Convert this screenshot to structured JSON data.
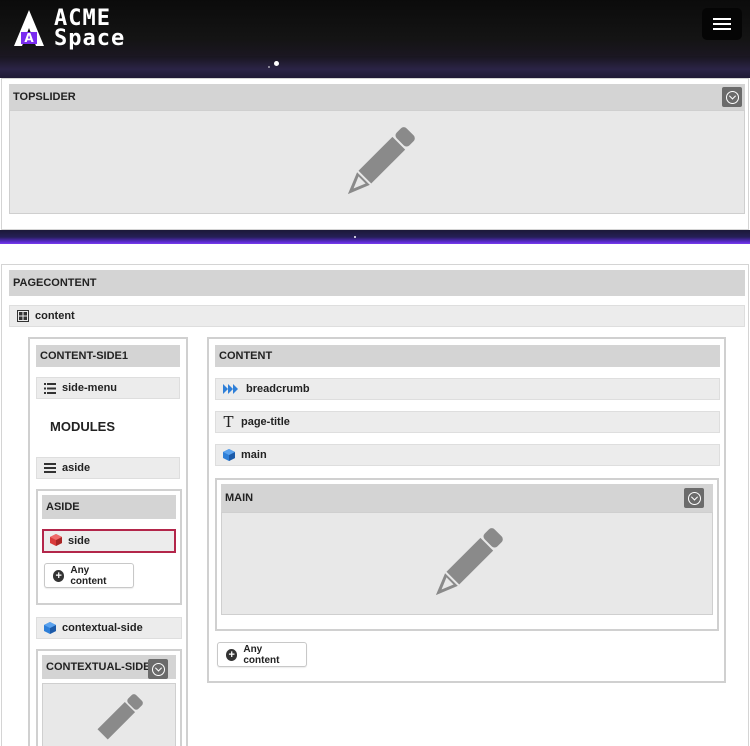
{
  "header": {
    "logo_alt": "ACME Space",
    "logo_line1": "ACME",
    "logo_line2": "Space",
    "menu_icon": "hamburger-icon"
  },
  "topslider": {
    "title": "TOPSLIDER",
    "toggle_icon": "chevron-down-circle-icon",
    "placeholder_icon": "pencil-icon"
  },
  "pagecontent": {
    "title": "PAGECONTENT",
    "content_item": {
      "label": "content",
      "icon": "grid-icon"
    },
    "side1": {
      "title": "CONTENT-SIDE1",
      "side_menu": {
        "label": "side-menu",
        "icon": "list-icon"
      },
      "modules_heading": "MODULES",
      "aside_item": {
        "label": "aside",
        "icon": "bars-icon"
      },
      "aside_block": {
        "title": "ASIDE",
        "side_item": {
          "label": "side",
          "icon": "red-cube-icon"
        },
        "any_content": "Any content"
      },
      "contextual_side": {
        "label": "contextual-side",
        "icon": "blue-cube-icon"
      },
      "contextual_block": {
        "title": "CONTEXTUAL-SIDE",
        "toggle_icon": "chevron-down-circle-icon"
      }
    },
    "content": {
      "title": "CONTENT",
      "breadcrumb": {
        "label": "breadcrumb",
        "icon": "fast-forward-icon"
      },
      "page_title": {
        "label": "page-title",
        "icon": "text-t-icon"
      },
      "main_item": {
        "label": "main",
        "icon": "blue-cube-icon"
      },
      "main_block": {
        "title": "MAIN",
        "toggle_icon": "chevron-down-circle-icon",
        "placeholder_icon": "pencil-icon"
      },
      "any_content": "Any content"
    }
  },
  "colors": {
    "header_bg": "#0b0b0b",
    "purple_strip": "#5b2bd0",
    "region_title_bg": "#d4d4d4",
    "region_body_bg": "#e8e8e8",
    "selected_border": "#b3264a",
    "toggle_bg": "#6b6b6b"
  }
}
